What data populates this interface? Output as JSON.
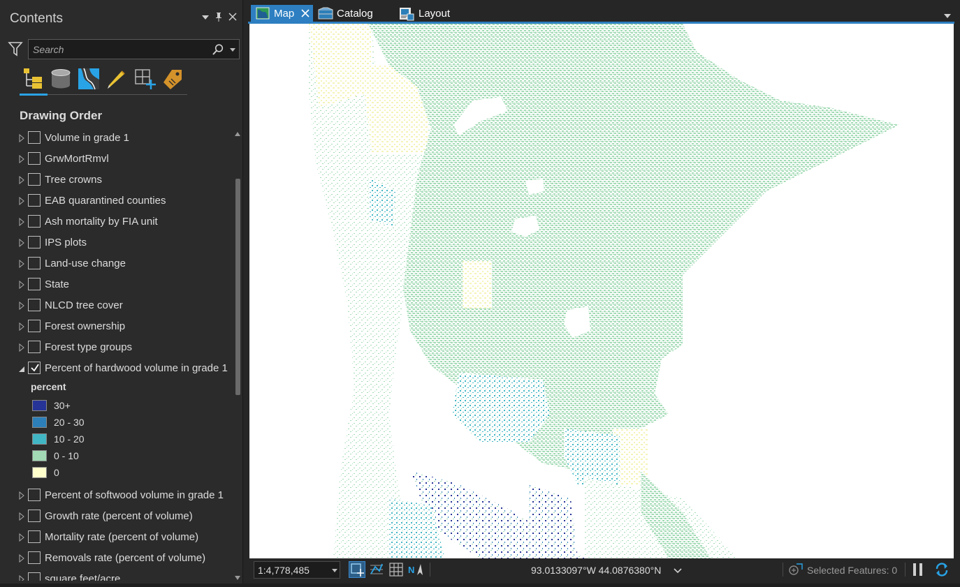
{
  "contents_pane": {
    "title": "Contents",
    "search_placeholder": "Search",
    "section_title": "Drawing Order",
    "tool_icons": [
      "drawing-order-icon",
      "data-source-icon",
      "selection-icon",
      "editing-icon",
      "snapping-icon",
      "labeling-icon"
    ],
    "layers_before": [
      {
        "label": "Volume in grade 1",
        "checked": false
      },
      {
        "label": "GrwMortRmvl",
        "checked": false
      },
      {
        "label": "Tree crowns",
        "checked": false
      },
      {
        "label": "EAB quarantined counties",
        "checked": false
      },
      {
        "label": "Ash mortality by FIA unit",
        "checked": false
      },
      {
        "label": "IPS plots",
        "checked": false
      },
      {
        "label": "Land-use change",
        "checked": false
      },
      {
        "label": "State",
        "checked": false
      },
      {
        "label": "NLCD tree cover",
        "checked": false
      },
      {
        "label": "Forest ownership",
        "checked": false
      },
      {
        "label": "Forest type groups",
        "checked": false
      }
    ],
    "expanded_layer": {
      "label": "Percent of hardwood volume in grade 1",
      "checked": true,
      "legend_heading": "percent",
      "legend": [
        {
          "label": "30+",
          "color": "#263497"
        },
        {
          "label": "20 - 30",
          "color": "#2c7fb8"
        },
        {
          "label": "10 - 20",
          "color": "#41b6c4"
        },
        {
          "label": "0 - 10",
          "color": "#a1dab4"
        },
        {
          "label": "0",
          "color": "#ffffcc"
        }
      ]
    },
    "layers_after": [
      {
        "label": "Percent of softwood volume in grade 1",
        "checked": false
      },
      {
        "label": "Growth rate (percent of volume)",
        "checked": false
      },
      {
        "label": "Mortality rate (percent of volume)",
        "checked": false
      },
      {
        "label": "Removals rate (percent of volume)",
        "checked": false
      },
      {
        "label": "square feet/acre",
        "checked": false
      }
    ]
  },
  "tabs": [
    {
      "label": "Map",
      "active": true,
      "icon": "map-icon"
    },
    {
      "label": "Catalog",
      "active": false,
      "icon": "catalog-icon"
    },
    {
      "label": "Layout",
      "active": false,
      "icon": "layout-icon"
    }
  ],
  "status_bar": {
    "scale": "1:4,778,485",
    "coordinates": "93.0133097°W 44.0876380°N",
    "selected_features": "Selected Features: 0"
  },
  "colors": {
    "accent": "#2d7fc1",
    "map_background": "#ffffff"
  }
}
